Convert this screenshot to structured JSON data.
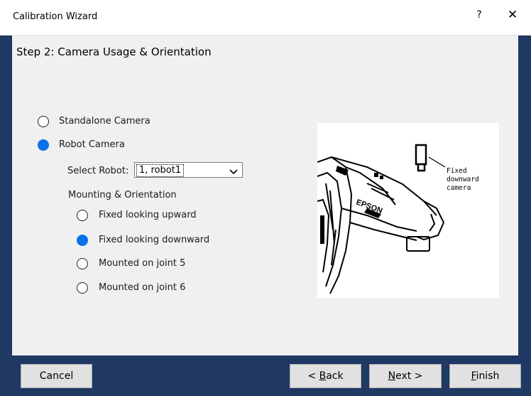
{
  "window": {
    "title": "Calibration Wizard",
    "help_label": "?",
    "close_label": "✕"
  },
  "step": {
    "title": "Step 2: Camera Usage & Orientation"
  },
  "camera_options": [
    {
      "label": "Standalone Camera",
      "selected": false
    },
    {
      "label": "Robot Camera",
      "selected": true
    }
  ],
  "select_robot": {
    "label": "Select Robot:",
    "value": "1, robot1"
  },
  "mounting": {
    "label": "Mounting & Orientation",
    "options": [
      {
        "label": "Fixed looking upward",
        "selected": false
      },
      {
        "label": "Fixed looking downward",
        "selected": true
      },
      {
        "label": "Mounted on joint 5",
        "selected": false
      },
      {
        "label": "Mounted on joint 6",
        "selected": false
      }
    ]
  },
  "illustration": {
    "caption_line1": "Fixed",
    "caption_line2": "downward",
    "caption_line3": "camera",
    "brand": "EPSON"
  },
  "buttons": {
    "cancel": "Cancel",
    "back_pre": "< ",
    "back_key": "B",
    "back_post": "ack",
    "next_key": "N",
    "next_post": "ext >",
    "finish_key": "F",
    "finish_post": "inish"
  },
  "colors": {
    "frame": "#1f3864",
    "radio_selected": "#0a72e8",
    "panel": "#f0f0f0"
  }
}
